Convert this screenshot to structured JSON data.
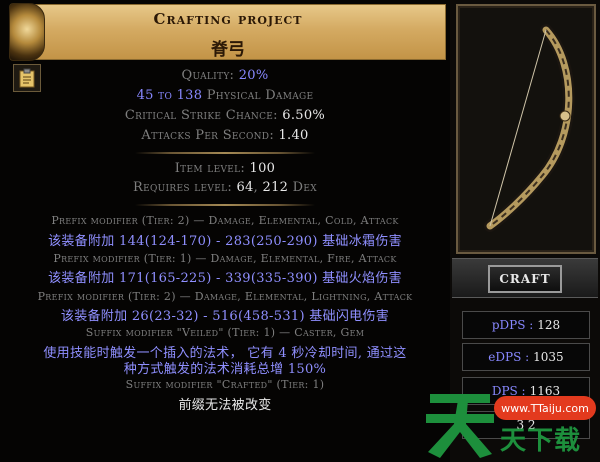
{
  "header": {
    "title": "Crafting project",
    "subtitle": "脊弓"
  },
  "properties": {
    "quality_label": "Quality:",
    "quality_value": "20%",
    "damage_min": "45",
    "damage_to": "to",
    "damage_max": "138",
    "damage_label": "Physical Damage",
    "crit_label": "Critical Strike Chance:",
    "crit_value": "6.50%",
    "aps_label": "Attacks Per Second:",
    "aps_value": "1.40"
  },
  "requirements": {
    "item_level_label": "Item level:",
    "item_level_value": "100",
    "req_label": "Requires level:",
    "req_level": "64",
    "req_sep": ",",
    "req_dex": "212",
    "req_dex_label": "Dex"
  },
  "mods": [
    {
      "header": "Prefix modifier (Tier: 2) — Damage, Elemental, Cold, Attack",
      "text": "该装备附加 144(124-170) - 283(250-290) 基础冰霜伤害"
    },
    {
      "header": "Prefix modifier (Tier: 1) — Damage, Elemental, Fire, Attack",
      "text": "该装备附加 171(165-225) - 339(335-390) 基础火焰伤害"
    },
    {
      "header": "Prefix modifier (Tier: 2) — Damage, Elemental, Lightning, Attack",
      "text": "该装备附加 26(23-32) - 516(458-531) 基础闪电伤害"
    },
    {
      "header": "Suffix modifier \"Veiled\" (Tier: 1) — Caster, Gem",
      "text_line1": "使用技能时触发一个插入的法术， 它有 4 秒冷却时间, 通过这",
      "text_line2": "种方式触发的法术消耗总增 150%"
    },
    {
      "header": "Suffix modifier \"Crafted\" (Tier: 1)",
      "text": "前缀无法被改变"
    }
  ],
  "side": {
    "craft_label": "CRAFT",
    "pdps_label": "pDPS :",
    "pdps_value": "128",
    "edps_label": "eDPS :",
    "edps_value": "1035",
    "tdps_label": "DPS :",
    "tdps_value": "1163",
    "extra_value": "3 2"
  },
  "watermark": {
    "url": "www.TTaiju.com",
    "brand": "天下载"
  },
  "colors": {
    "header_gold": "#d4aa62",
    "magic_blue": "#8888ff",
    "label_grey": "#7f7f7f",
    "value_white": "#e8e8e8",
    "watermark_green": "#1d8f3c",
    "watermark_red": "#e33a1e"
  }
}
